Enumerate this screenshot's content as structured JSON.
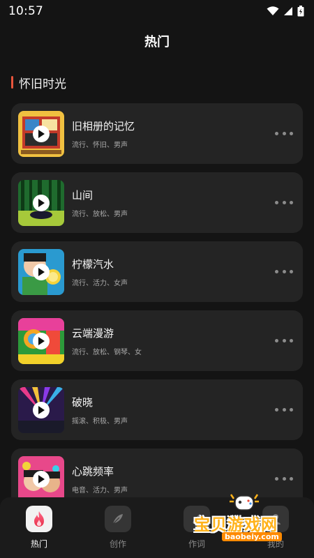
{
  "status": {
    "time": "10:57"
  },
  "header": {
    "title": "热门"
  },
  "section": {
    "title": "怀旧时光"
  },
  "songs": [
    {
      "title": "旧相册的记忆",
      "tags": "流行、怀旧、男声"
    },
    {
      "title": "山间",
      "tags": "流行、放松、男声"
    },
    {
      "title": "柠檬汽水",
      "tags": "流行、活力、女声"
    },
    {
      "title": "云端漫游",
      "tags": "流行、放松、钢琴、女"
    },
    {
      "title": "破晓",
      "tags": "摇滚、积极、男声"
    },
    {
      "title": "心跳频率",
      "tags": "电音、活力、男声"
    }
  ],
  "nav": {
    "hot": "热门",
    "create": "创作",
    "lyrics": "作词",
    "mine": "我的"
  },
  "watermark": {
    "text": "宝贝游戏网",
    "url": "baobeiy.com"
  },
  "colors": {
    "accent": "#e8553c",
    "background": "#141414",
    "card": "#242424"
  }
}
